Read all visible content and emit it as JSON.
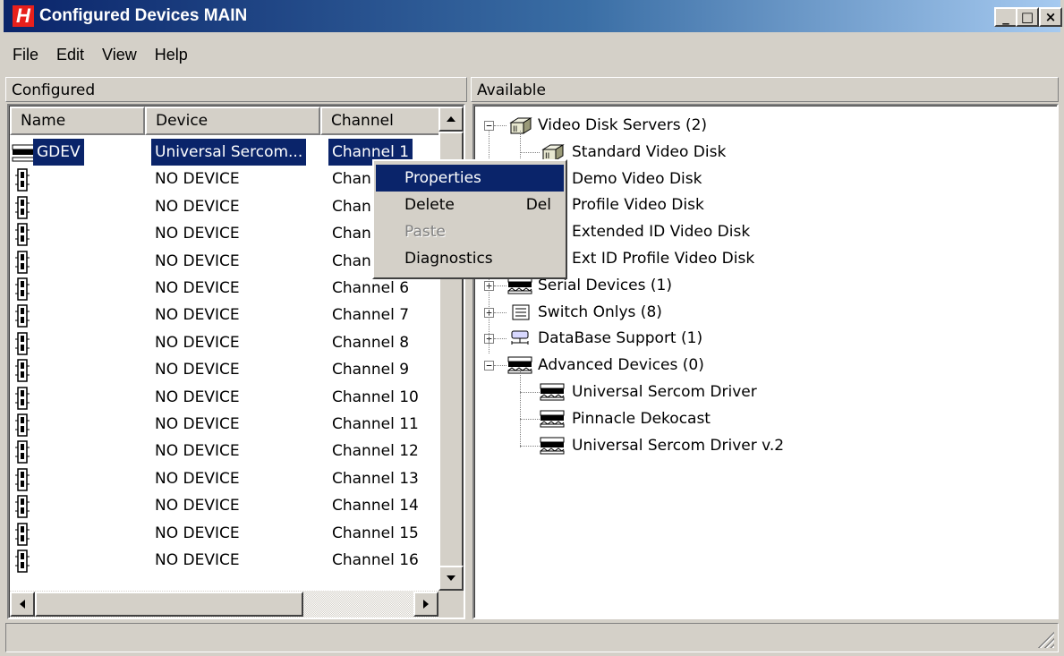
{
  "window": {
    "app_icon_letter": "H",
    "title": "Configured Devices MAIN",
    "minimize_glyph": "_",
    "maximize_glyph": "□",
    "close_glyph": "×"
  },
  "menubar": [
    "File",
    "Edit",
    "View",
    "Help"
  ],
  "configured": {
    "label": "Configured",
    "columns": [
      "Name",
      "Device",
      "Channel"
    ],
    "rows": [
      {
        "name": "GDEV",
        "device": "Universal Sercom...",
        "channel": "Channel 1",
        "icon": "device-chip-icon"
      },
      {
        "name": "",
        "device": "NO DEVICE",
        "channel": "Chan",
        "icon": "plug-icon"
      },
      {
        "name": "",
        "device": "NO DEVICE",
        "channel": "Chan",
        "icon": "plug-icon"
      },
      {
        "name": "",
        "device": "NO DEVICE",
        "channel": "Chan",
        "icon": "plug-icon"
      },
      {
        "name": "",
        "device": "NO DEVICE",
        "channel": "Chan",
        "icon": "plug-icon"
      },
      {
        "name": "",
        "device": "NO DEVICE",
        "channel": "Channel 6",
        "icon": "plug-icon"
      },
      {
        "name": "",
        "device": "NO DEVICE",
        "channel": "Channel 7",
        "icon": "plug-icon"
      },
      {
        "name": "",
        "device": "NO DEVICE",
        "channel": "Channel 8",
        "icon": "plug-icon"
      },
      {
        "name": "",
        "device": "NO DEVICE",
        "channel": "Channel 9",
        "icon": "plug-icon"
      },
      {
        "name": "",
        "device": "NO DEVICE",
        "channel": "Channel 10",
        "icon": "plug-icon"
      },
      {
        "name": "",
        "device": "NO DEVICE",
        "channel": "Channel 11",
        "icon": "plug-icon"
      },
      {
        "name": "",
        "device": "NO DEVICE",
        "channel": "Channel 12",
        "icon": "plug-icon"
      },
      {
        "name": "",
        "device": "NO DEVICE",
        "channel": "Channel 13",
        "icon": "plug-icon"
      },
      {
        "name": "",
        "device": "NO DEVICE",
        "channel": "Channel 14",
        "icon": "plug-icon"
      },
      {
        "name": "",
        "device": "NO DEVICE",
        "channel": "Channel 15",
        "icon": "plug-icon"
      },
      {
        "name": "",
        "device": "NO DEVICE",
        "channel": "Channel 16",
        "icon": "plug-icon"
      }
    ]
  },
  "context_menu": {
    "items": [
      {
        "label": "Properties",
        "shortcut": "",
        "state": "highlighted"
      },
      {
        "label": "Delete",
        "shortcut": "Del",
        "state": "enabled"
      },
      {
        "label": "Paste",
        "shortcut": "",
        "state": "disabled"
      },
      {
        "label": "Diagnostics",
        "shortcut": "",
        "state": "enabled"
      }
    ]
  },
  "available": {
    "label": "Available",
    "tree": [
      {
        "label": "Video Disk Servers (2)",
        "level": 0,
        "expander": "−",
        "icon": "video-disk-server-icon"
      },
      {
        "label": "Standard Video Disk",
        "level": 1,
        "icon": "video-disk-icon"
      },
      {
        "label": "Demo Video Disk",
        "level": 1,
        "icon": "video-disk-icon"
      },
      {
        "label": "Profile Video Disk",
        "level": 1,
        "icon": "video-disk-icon"
      },
      {
        "label": "Extended ID Video Disk",
        "level": 1,
        "icon": "video-disk-icon"
      },
      {
        "label": "Ext ID Profile Video Disk",
        "level": 1,
        "icon": "video-disk-icon"
      },
      {
        "label": "Serial Devices (1)",
        "level": 0,
        "expander": "+",
        "icon": "serial-device-icon"
      },
      {
        "label": "Switch Onlys (8)",
        "level": 0,
        "expander": "+",
        "icon": "switch-icon"
      },
      {
        "label": "DataBase Support (1)",
        "level": 0,
        "expander": "+",
        "icon": "database-icon"
      },
      {
        "label": "Advanced Devices (0)",
        "level": 0,
        "expander": "−",
        "icon": "advanced-device-icon"
      },
      {
        "label": "Universal Sercom Driver",
        "level": 1,
        "icon": "device-chip-icon"
      },
      {
        "label": "Pinnacle Dekocast",
        "level": 1,
        "icon": "device-chip-icon"
      },
      {
        "label": "Universal Sercom Driver v.2",
        "level": 1,
        "icon": "device-chip-icon"
      }
    ]
  },
  "status_text": ""
}
